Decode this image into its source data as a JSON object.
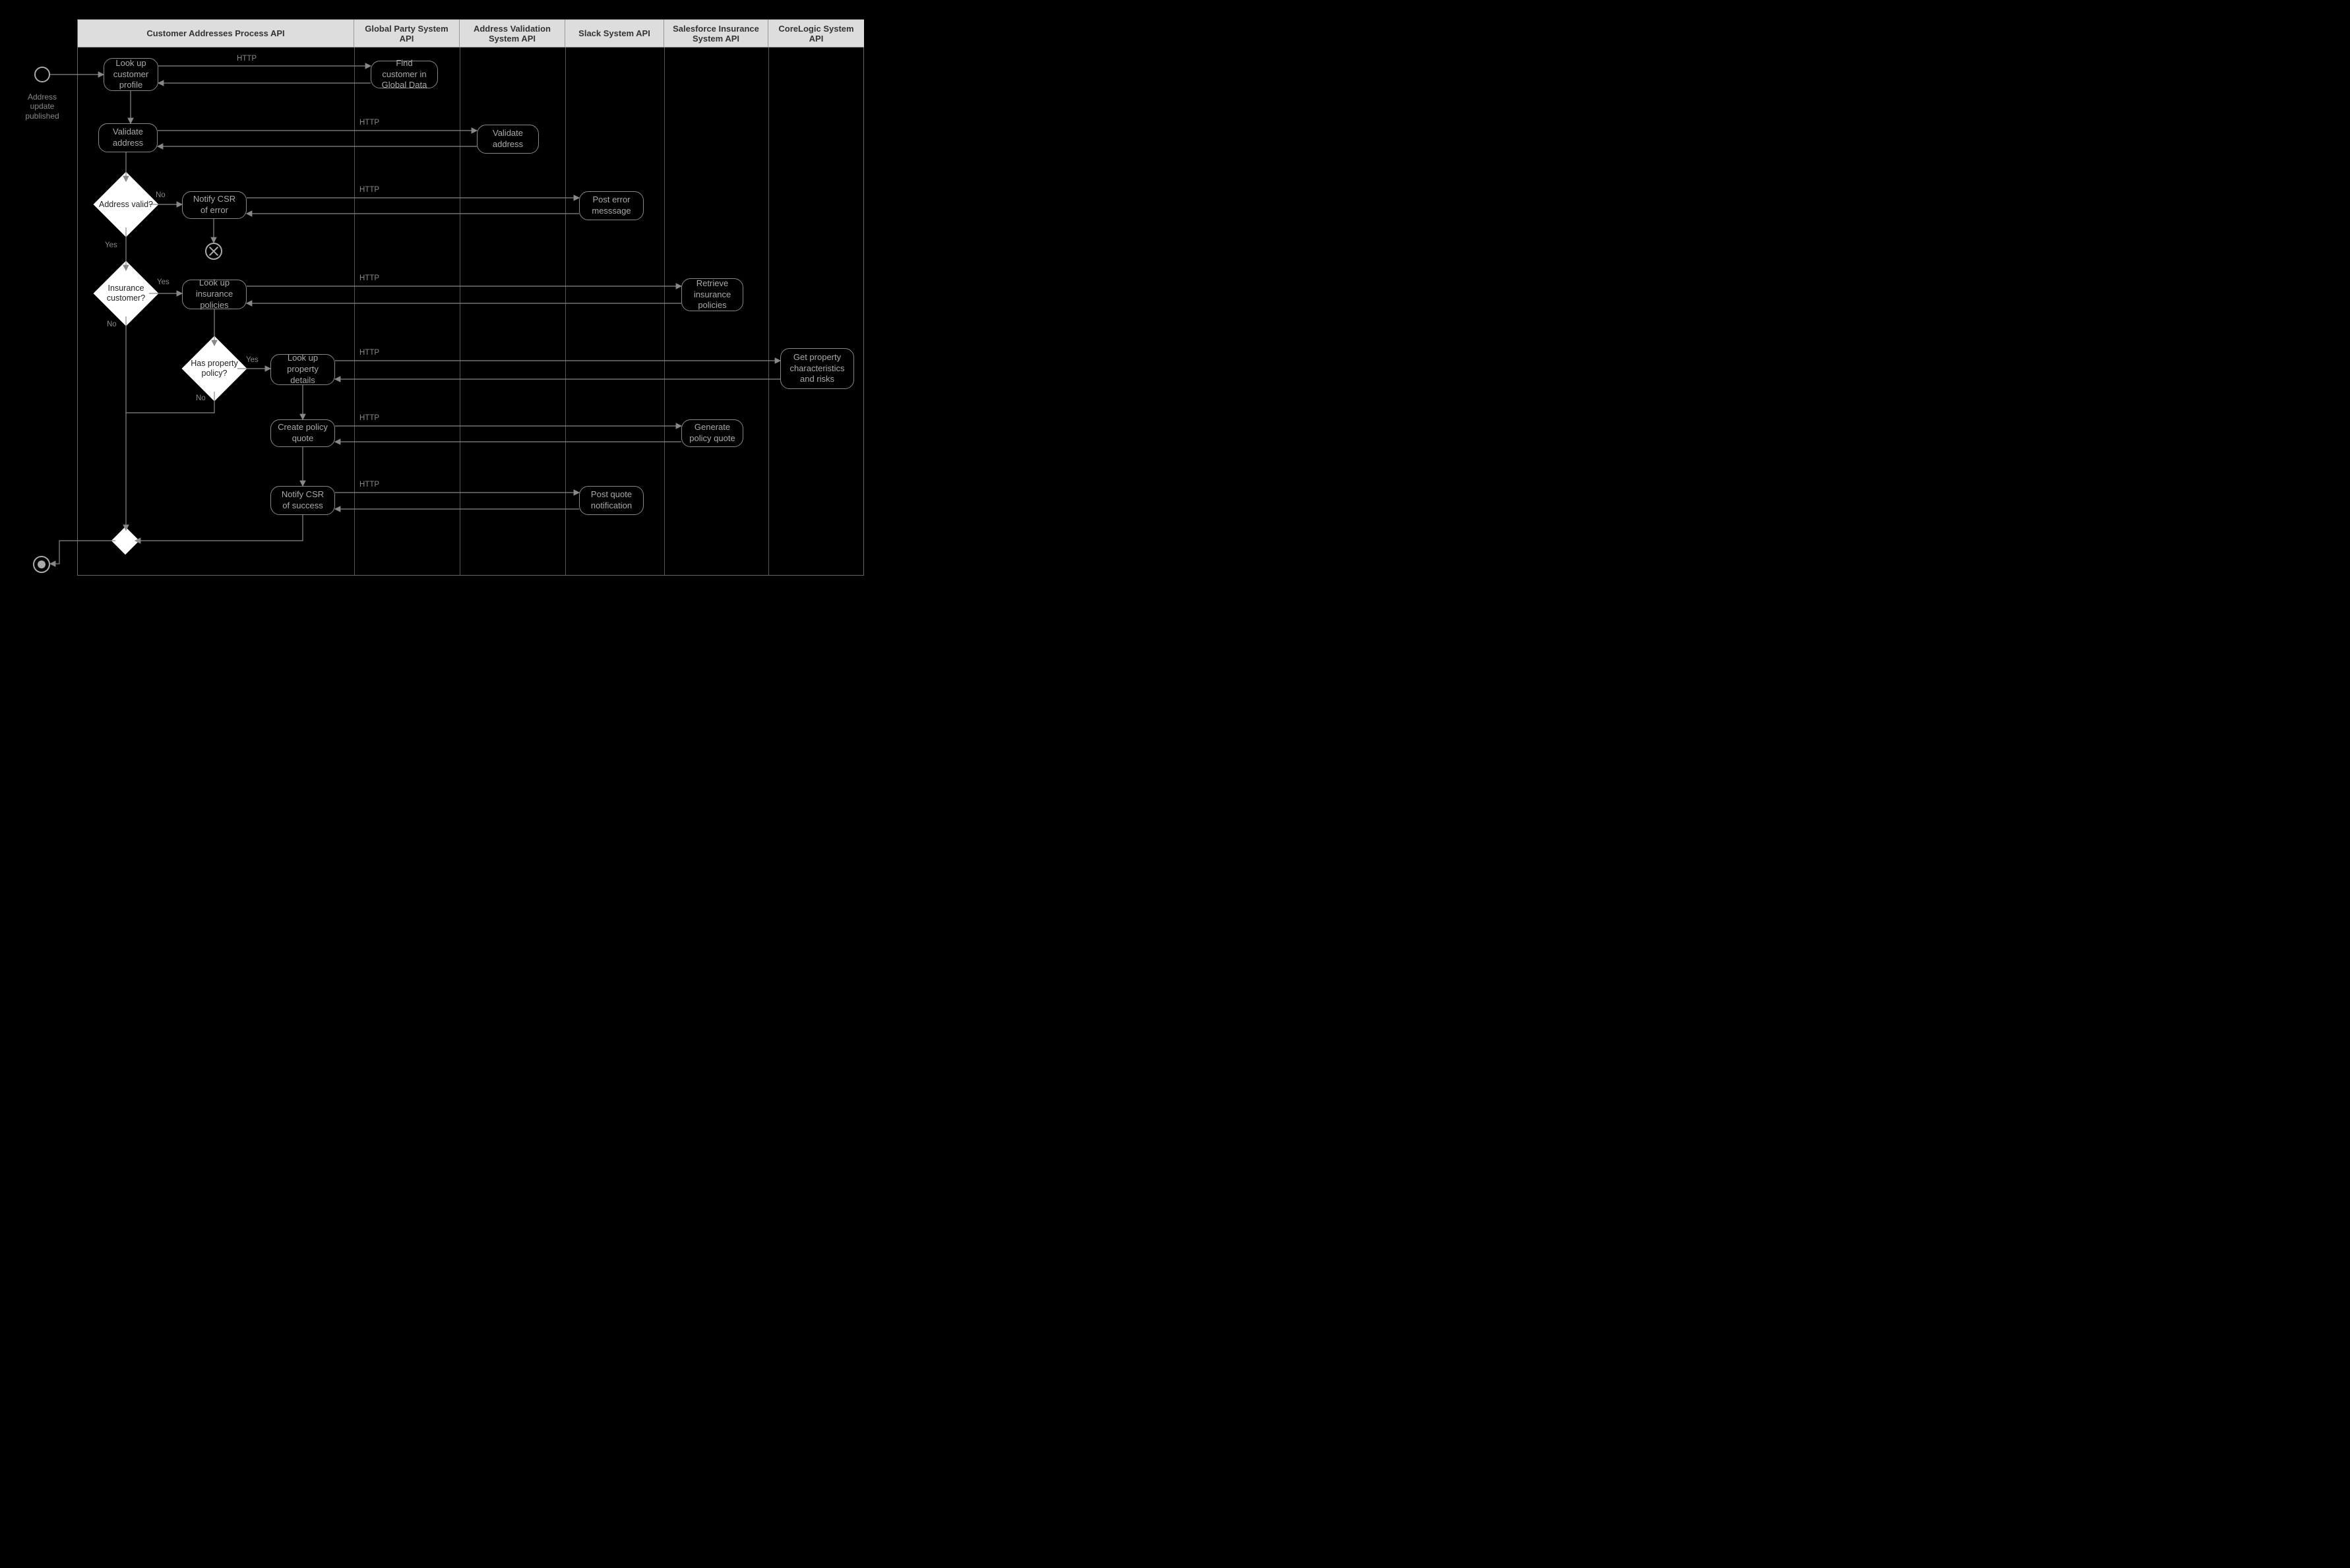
{
  "start_label": "Address update published",
  "lanes": {
    "process": "Customer Addresses Process API",
    "global": "Global Party System API",
    "addrval": "Address Validation System API",
    "slack": "Slack System API",
    "sfins": "Salesforce Insurance System API",
    "core": "CoreLogic System API"
  },
  "nodes": {
    "lookup_profile": "Look up customer profile",
    "find_customer": "Find customer in Global Data",
    "validate_addr": "Validate address",
    "validate_addr_rt": "Validate address",
    "notify_err": "Notify CSR of error",
    "post_error": "Post error messsage",
    "lookup_policies": "Look up insurance policies",
    "retrieve_policies": "Retrieve insurance policies",
    "lookup_property": "Look up property details",
    "get_property": "Get property characteristics and risks",
    "create_quote": "Create policy quote",
    "gen_quote": "Generate policy quote",
    "notify_success": "Notify CSR of success",
    "post_quote": "Post quote notification"
  },
  "decisions": {
    "address_valid": "Address valid?",
    "insurance_cust": "Insurance customer?",
    "has_property": "Has property policy?"
  },
  "edge_labels": {
    "http": "HTTP",
    "yes": "Yes",
    "no": "No"
  }
}
